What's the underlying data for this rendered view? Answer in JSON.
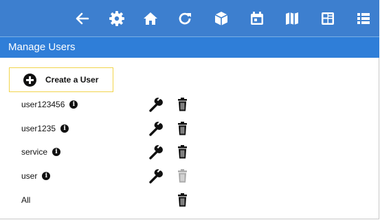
{
  "toolbar": {
    "icons": [
      "back-arrow-icon",
      "gear-icon",
      "home-icon",
      "refresh-icon",
      "cube-icon",
      "calendar-icon",
      "map-icon",
      "dashboard-icon",
      "list-icon"
    ],
    "color": "#3d7fcf"
  },
  "header": {
    "title": "Manage Users",
    "color": "#2f7ed8"
  },
  "create_button": {
    "label": "Create a User",
    "border_color": "#f1d44a"
  },
  "users": [
    {
      "name": "user123456",
      "has_info": true,
      "edit": true,
      "delete_enabled": true
    },
    {
      "name": "user1235",
      "has_info": true,
      "edit": true,
      "delete_enabled": true
    },
    {
      "name": "service",
      "has_info": true,
      "edit": true,
      "delete_enabled": true
    },
    {
      "name": "user",
      "has_info": true,
      "edit": true,
      "delete_enabled": false
    },
    {
      "name": "All",
      "has_info": false,
      "edit": false,
      "delete_enabled": true
    }
  ]
}
